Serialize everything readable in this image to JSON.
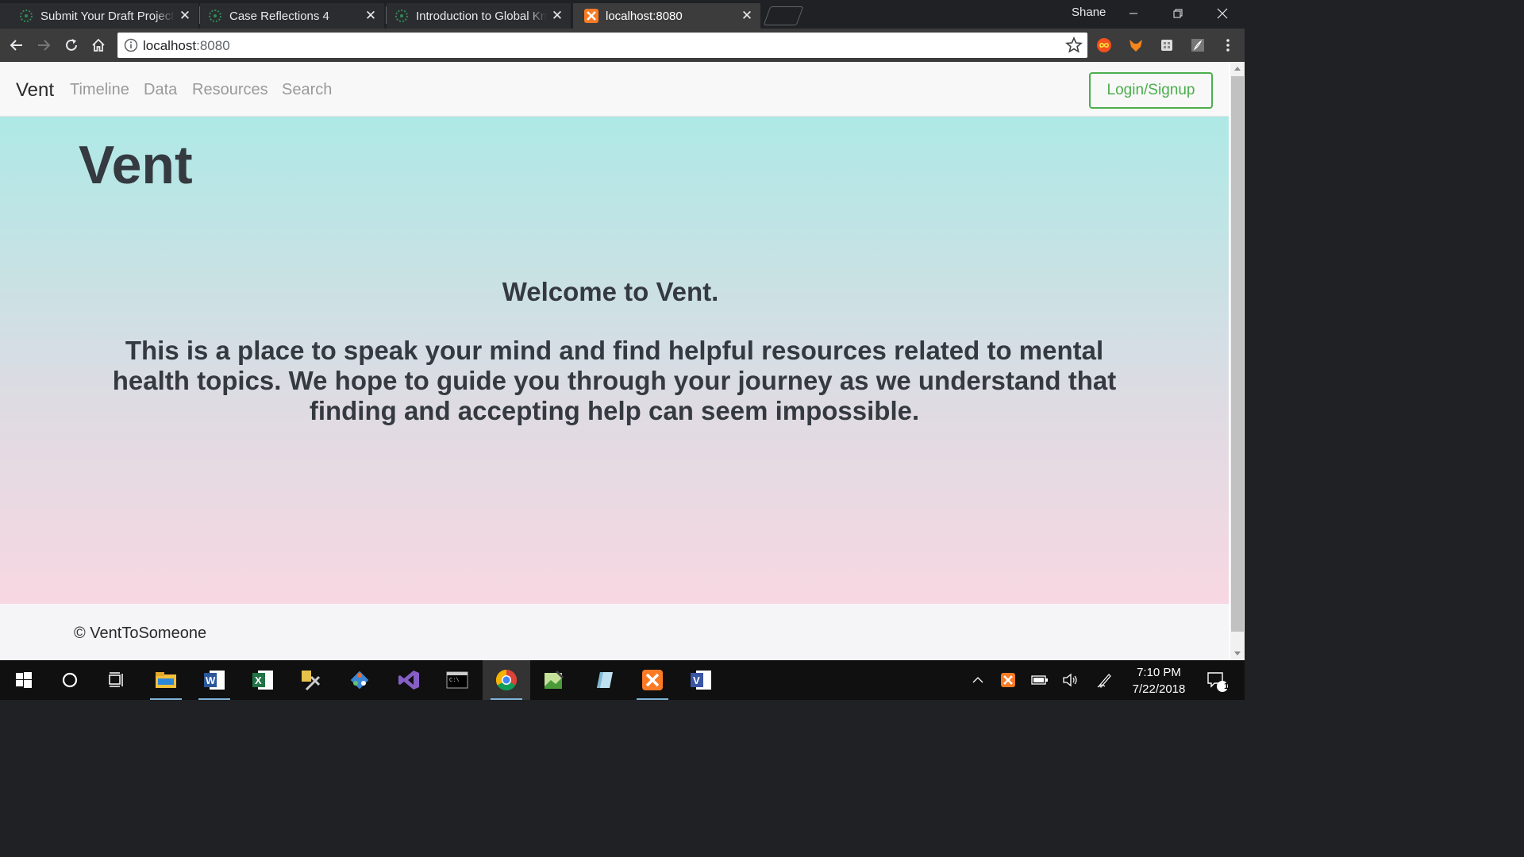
{
  "browser": {
    "tabs": [
      {
        "title": "Submit Your Draft Project",
        "icon": "canvas-icon"
      },
      {
        "title": "Case Reflections 4",
        "icon": "canvas-icon"
      },
      {
        "title": "Introduction to Global Kn",
        "icon": "canvas-icon"
      },
      {
        "title": "localhost:8080",
        "icon": "xampp-icon",
        "active": true
      }
    ],
    "profile_name": "Shane",
    "address_host": "localhost",
    "address_port": ":8080"
  },
  "navbar": {
    "brand": "Vent",
    "links": [
      "Timeline",
      "Data",
      "Resources",
      "Search"
    ],
    "login_label": "Login/Signup"
  },
  "hero": {
    "title": "Vent",
    "welcome": "Welcome to Vent.",
    "description": "This is a place to speak your mind and find helpful resources related to mental health topics. We hope to guide you through your journey as we understand that finding and accepting help can seem impossible."
  },
  "footer": {
    "text": "© VentToSomeone"
  },
  "taskbar": {
    "time": "7:10 PM",
    "date": "7/22/2018",
    "notification_count": "1"
  },
  "colors": {
    "accent_green": "#4cae4c",
    "hero_top": "#aee9e6",
    "hero_bottom": "#f7d7e2",
    "text_dark": "#343a40"
  }
}
